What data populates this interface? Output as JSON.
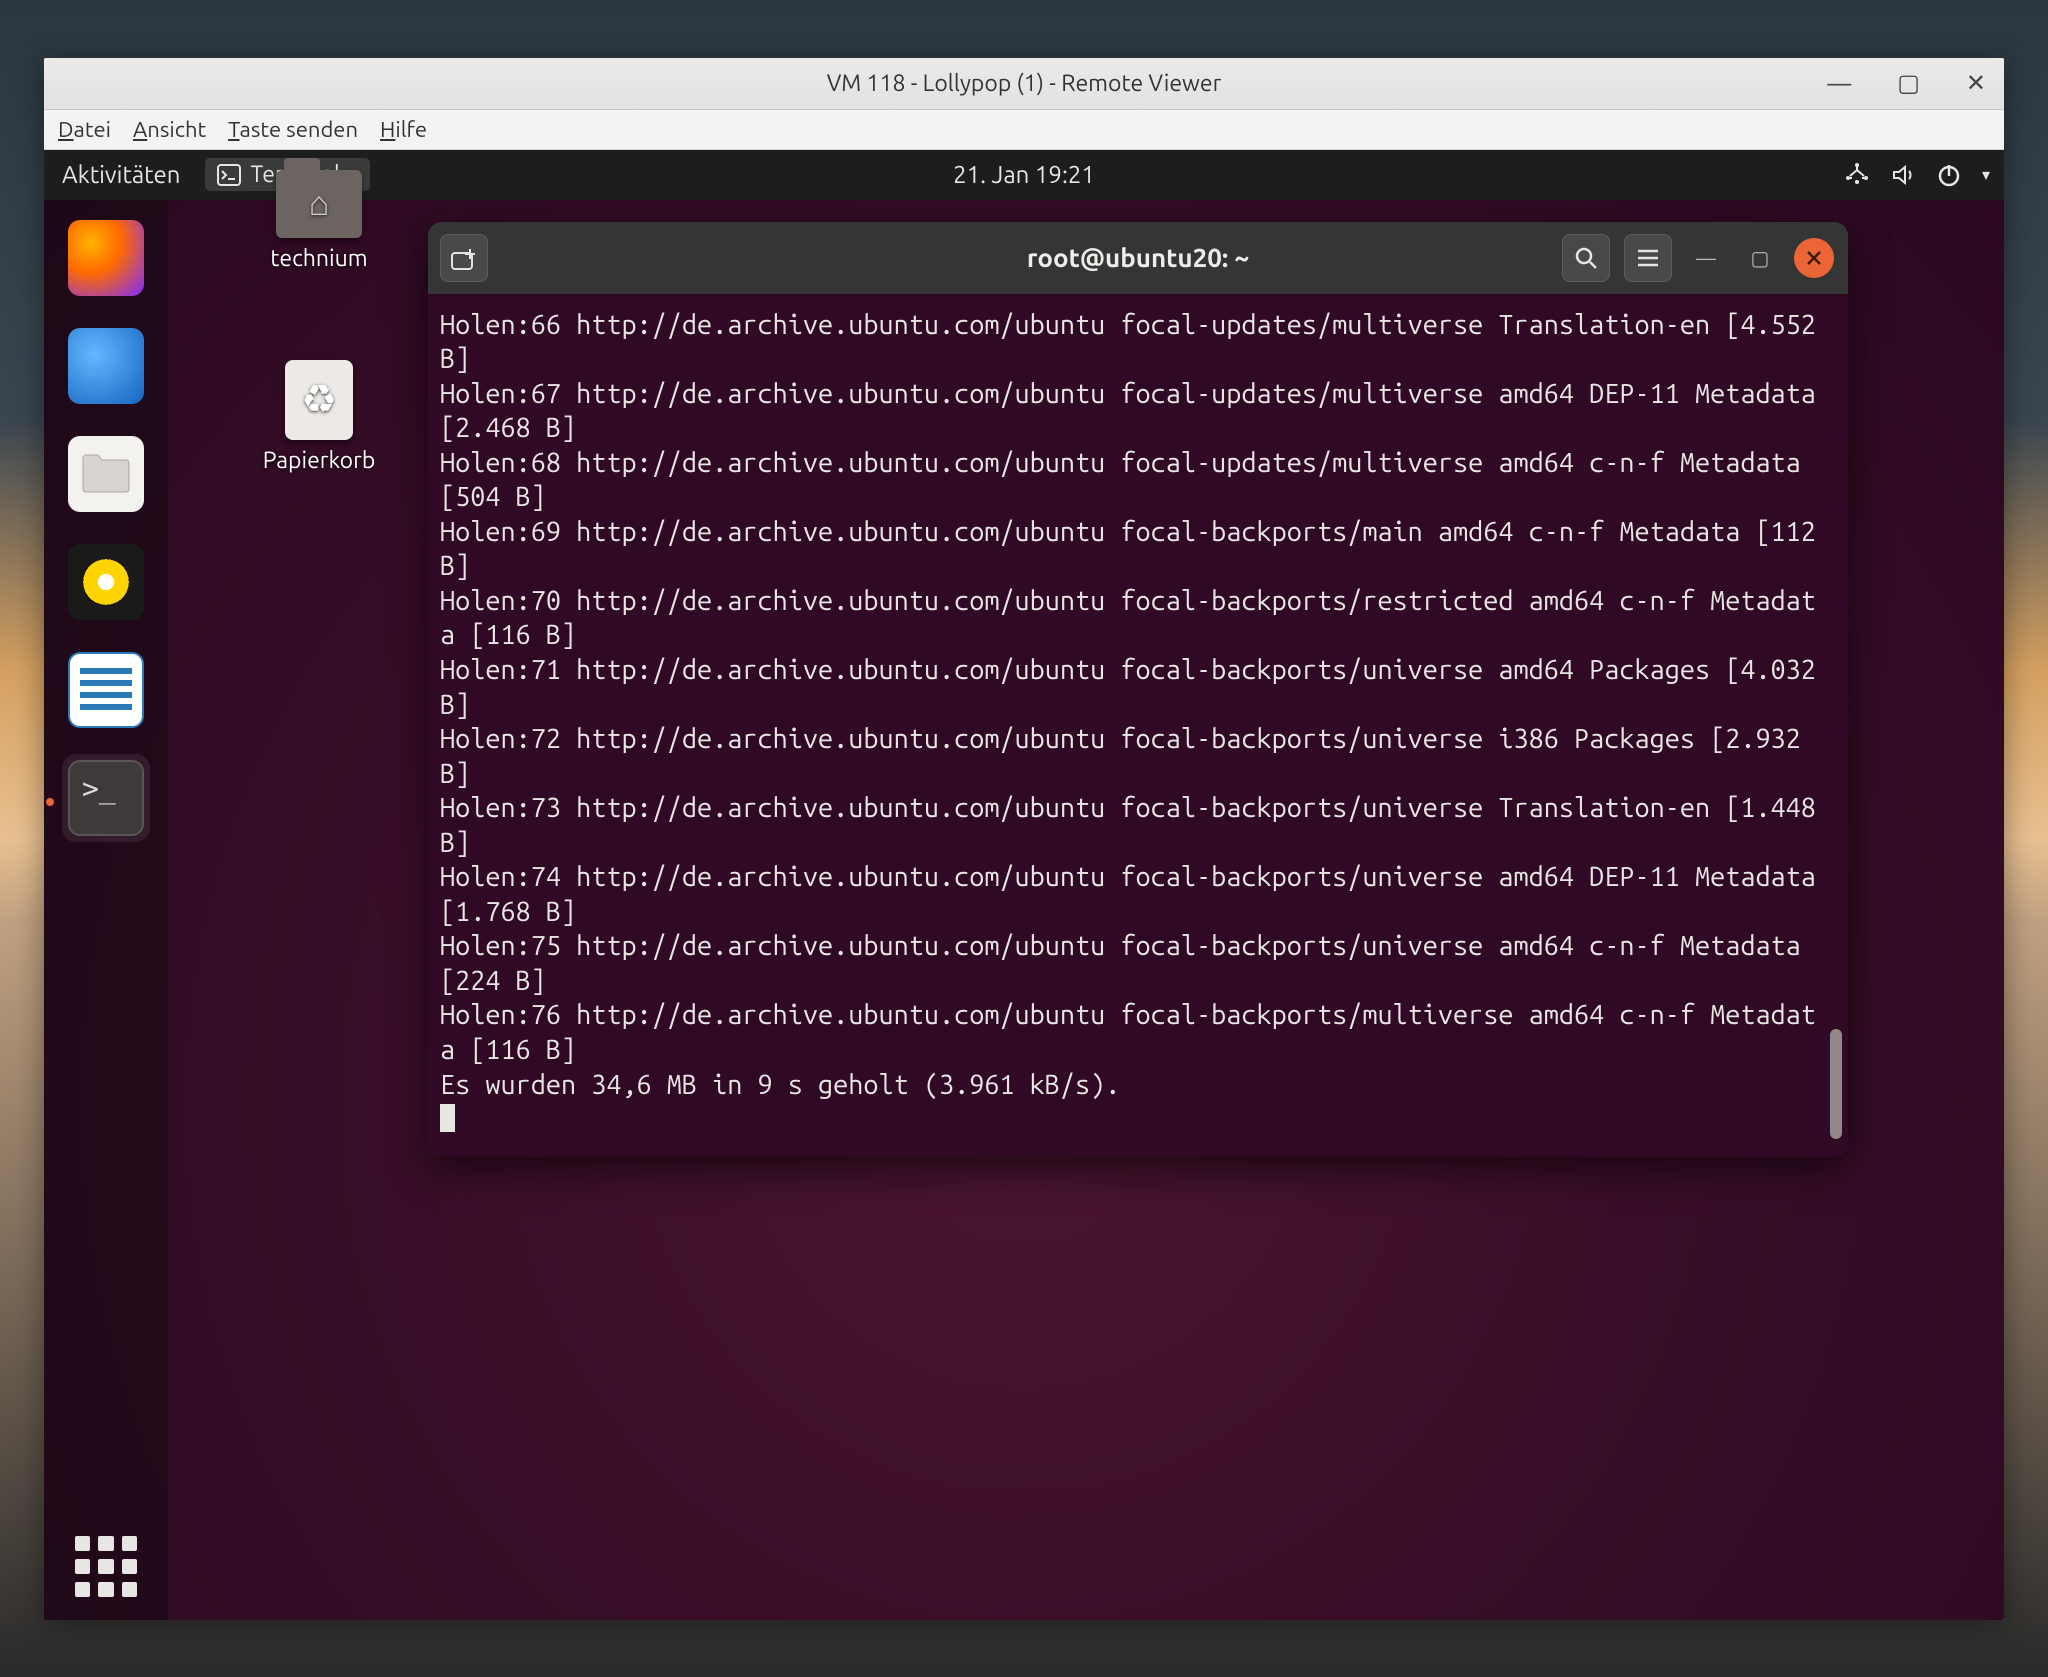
{
  "viewer": {
    "title": "VM 118 - Lollypop (1) - Remote Viewer",
    "menu": {
      "datei": "Datei",
      "ansicht": "Ansicht",
      "taste": "Taste senden",
      "hilfe": "Hilfe"
    }
  },
  "topbar": {
    "activities": "Aktivitäten",
    "app_label": "Terminal",
    "clock": "21. Jan  19:21"
  },
  "desktop": {
    "home_folder": "technium",
    "trash": "Papierkorb"
  },
  "terminal": {
    "title": "root@ubuntu20: ~",
    "output": "Holen:66 http://de.archive.ubuntu.com/ubuntu focal-updates/multiverse Translation-en [4.552 B]\nHolen:67 http://de.archive.ubuntu.com/ubuntu focal-updates/multiverse amd64 DEP-11 Metadata [2.468 B]\nHolen:68 http://de.archive.ubuntu.com/ubuntu focal-updates/multiverse amd64 c-n-f Metadata [504 B]\nHolen:69 http://de.archive.ubuntu.com/ubuntu focal-backports/main amd64 c-n-f Metadata [112 B]\nHolen:70 http://de.archive.ubuntu.com/ubuntu focal-backports/restricted amd64 c-n-f Metadata [116 B]\nHolen:71 http://de.archive.ubuntu.com/ubuntu focal-backports/universe amd64 Packages [4.032 B]\nHolen:72 http://de.archive.ubuntu.com/ubuntu focal-backports/universe i386 Packages [2.932 B]\nHolen:73 http://de.archive.ubuntu.com/ubuntu focal-backports/universe Translation-en [1.448 B]\nHolen:74 http://de.archive.ubuntu.com/ubuntu focal-backports/universe amd64 DEP-11 Metadata [1.768 B]\nHolen:75 http://de.archive.ubuntu.com/ubuntu focal-backports/universe amd64 c-n-f Metadata [224 B]\nHolen:76 http://de.archive.ubuntu.com/ubuntu focal-backports/multiverse amd64 c-n-f Metadata [116 B]\nEs wurden 34,6 MB in 9 s geholt (3.961 kB/s)."
  }
}
